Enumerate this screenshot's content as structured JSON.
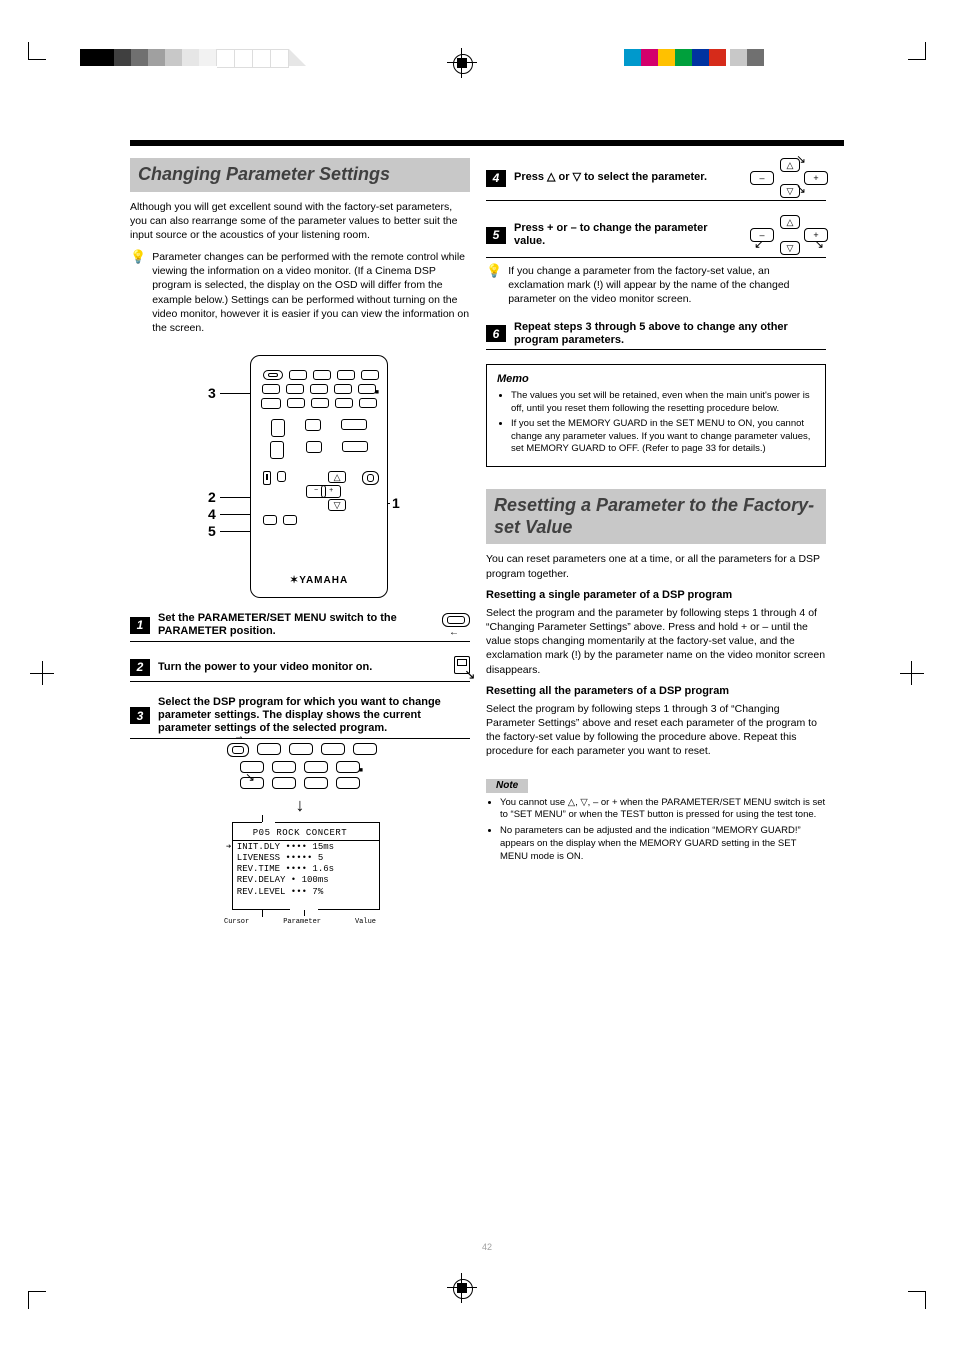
{
  "pageHeaderColorBarLeft": [
    "#000000",
    "#000000",
    "#404040",
    "#707070",
    "#a0a0a0",
    "#c8c8c8",
    "#e6e6e6",
    "#f2f2f2",
    "#ffffff",
    "#ffffff",
    "#ffffff"
  ],
  "pageHeaderColorBarRight": [
    "#0099cc",
    "#d3006c",
    "#ffc100",
    "#00a03c",
    "#0033a0",
    "#d62b1a",
    "#c8c8c8",
    "#707070"
  ],
  "left": {
    "sectionTitle": "Changing Parameter Settings",
    "intro": "Although you will get excellent sound with the factory-set parameters, you can also rearrange some of the parameter values to better suit the input source or the acoustics of your listening room.",
    "hint": "Parameter changes can be performed with the remote control while viewing the information on a video monitor. (If a Cinema DSP program is selected, the display on the OSD will differ from the example below.) Settings can be performed without turning on the video monitor, however it is easier if you can view the information on the screen.",
    "remoteCallouts": [
      "3",
      "2",
      "4",
      "5",
      "1"
    ],
    "remoteBrand": "YAMAHA",
    "step1": {
      "n": "1",
      "txt": "Set the PARAMETER/SET MENU switch to the PARAMETER position."
    },
    "step2": {
      "n": "2",
      "txt": "Turn the power to your video monitor on."
    },
    "step3": {
      "n": "3",
      "txt": "Select the DSP program for which you want to change parameter settings. The display shows the current parameter settings of the selected program."
    },
    "lcd": {
      "title": "P05 ROCK CONCERT",
      "lines": [
        "➔ INIT.DLY •••• 15ms",
        "  LIVENESS ••••• 5",
        "  REV.TIME •••• 1.6s",
        "  REV.DELAY • 100ms",
        "  REV.LEVEL ••• 7%"
      ],
      "captions": [
        "Cursor",
        "Parameter",
        "Value"
      ]
    }
  },
  "right": {
    "step4": {
      "n": "4",
      "txt": "Press △ or ▽ to select the parameter."
    },
    "step5": {
      "n": "5",
      "txt": "Press + or – to change the parameter value."
    },
    "step5hint": "If you change a parameter from the factory-set value, an exclamation mark (!) will appear by the name of the changed parameter on the video monitor screen.",
    "step6": {
      "n": "6",
      "txt": "Repeat steps 3 through 5 above to change any other program parameters."
    },
    "memo": {
      "title": "Memo",
      "items": [
        "The values you set will be retained, even when the main unit's power is off, until you reset them following the resetting procedure below.",
        "If you set the MEMORY GUARD in the SET MENU to ON, you cannot change any parameter values. If you want to change parameter values, set MEMORY GUARD to OFF. (Refer to page 33 for details.)"
      ]
    },
    "resetTitle": "Resetting a Parameter to the Factory-set Value",
    "resetPara1": "You can reset parameters one at a time, or all the parameters for a DSP program together.",
    "resetSub1": "Resetting a single parameter of a DSP program",
    "resetSub1Body": "Select the program and the parameter by following steps 1 through 4 of “Changing Parameter Settings” above. Press and hold + or – until the value stops changing momentarily at the factory-set value, and the exclamation mark (!) by the parameter name on the video monitor screen disappears.",
    "resetSub2": "Resetting all the parameters of a DSP program",
    "resetSub2Body": "Select the program by following steps 1 through 3 of “Changing Parameter Settings” above and reset each parameter of the program to the factory-set value by following the procedure above. Repeat this procedure for each parameter you want to reset.",
    "noteLabel": "Note",
    "notes": [
      "You cannot use △, ▽, – or + when the PARAMETER/SET MENU switch is set to “SET MENU” or when the TEST button is pressed for using the test tone.",
      "No parameters can be adjusted and the indication “MEMORY GUARD!” appears on the display when the MEMORY GUARD setting in the SET MENU mode is ON."
    ]
  },
  "pageNumber": "42",
  "pressPad": {
    "up": "△",
    "down": "▽",
    "left": "–",
    "right": "+"
  }
}
